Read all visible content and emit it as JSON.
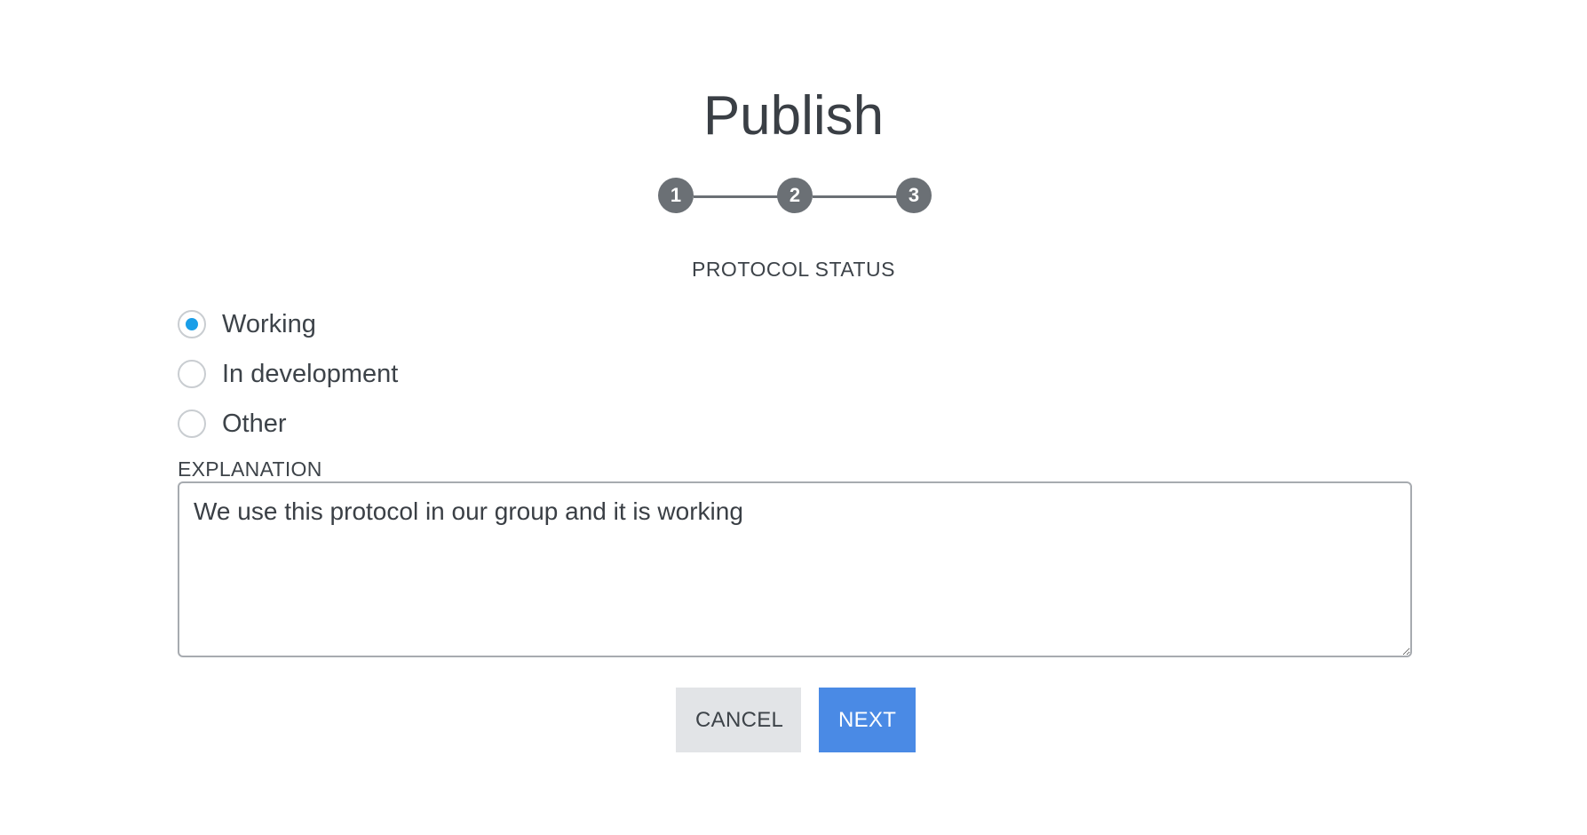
{
  "dialog": {
    "title": "Publish"
  },
  "stepper": {
    "steps": [
      {
        "label": "1"
      },
      {
        "label": "2"
      },
      {
        "label": "3"
      }
    ]
  },
  "protocol_status": {
    "label": "PROTOCOL STATUS",
    "options": [
      {
        "label": "Working",
        "selected": true
      },
      {
        "label": "In development",
        "selected": false
      },
      {
        "label": "Other",
        "selected": false
      }
    ]
  },
  "explanation": {
    "label": "EXPLANATION",
    "value": "We use this protocol in our group and it is working"
  },
  "actions": {
    "cancel_label": "CANCEL",
    "next_label": "NEXT"
  },
  "colors": {
    "accent": "#4a8ae5",
    "radio_selected": "#1a9ee8",
    "step": "#6b7075"
  }
}
